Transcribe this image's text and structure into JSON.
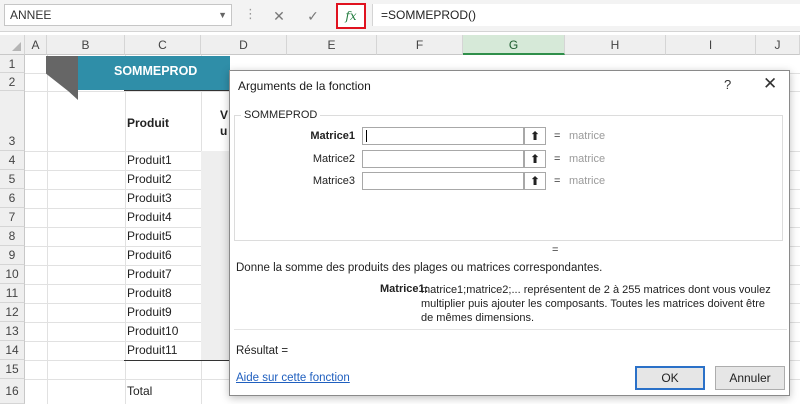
{
  "formula_bar": {
    "name_box": "ANNEE",
    "cancel_icon": "✕",
    "enter_icon": "✓",
    "fx_label": "fx",
    "formula": "=SOMMEPROD()"
  },
  "columns": [
    "A",
    "B",
    "C",
    "D",
    "E",
    "F",
    "G",
    "H",
    "I",
    "J"
  ],
  "rows": [
    "1",
    "2",
    "3",
    "4",
    "5",
    "6",
    "7",
    "8",
    "9",
    "10",
    "11",
    "12",
    "13",
    "14",
    "15",
    "16"
  ],
  "sheet": {
    "banner": "SOMMEPROD",
    "header_produit": "Produit",
    "header_partial_line1": "V",
    "header_partial_line2": "u",
    "products": [
      "Produit1",
      "Produit2",
      "Produit3",
      "Produit4",
      "Produit5",
      "Produit6",
      "Produit7",
      "Produit8",
      "Produit9",
      "Produit10",
      "Produit11"
    ],
    "total_label": "Total"
  },
  "dialog": {
    "title": "Arguments de la fonction",
    "help_icon": "?",
    "close_icon": "✕",
    "function_name": "SOMMEPROD",
    "args": [
      {
        "label": "Matrice1",
        "value": "",
        "equals": "=",
        "hint": "matrice"
      },
      {
        "label": "Matrice2",
        "value": "",
        "equals": "=",
        "hint": "matrice"
      },
      {
        "label": "Matrice3",
        "value": "",
        "equals": "=",
        "hint": "matrice"
      }
    ],
    "result_equals": "=",
    "description": "Donne la somme des produits des plages ou matrices correspondantes.",
    "arg_desc_name": "Matrice1:",
    "arg_desc_text": "matrice1;matrice2;... représentent de 2 à 255 matrices dont vous voulez multiplier puis ajouter les composants. Toutes les matrices doivent être de mêmes dimensions.",
    "result_label": "Résultat =",
    "help_link": "Aide sur cette fonction",
    "ok_label": "OK",
    "cancel_label": "Annuler"
  }
}
